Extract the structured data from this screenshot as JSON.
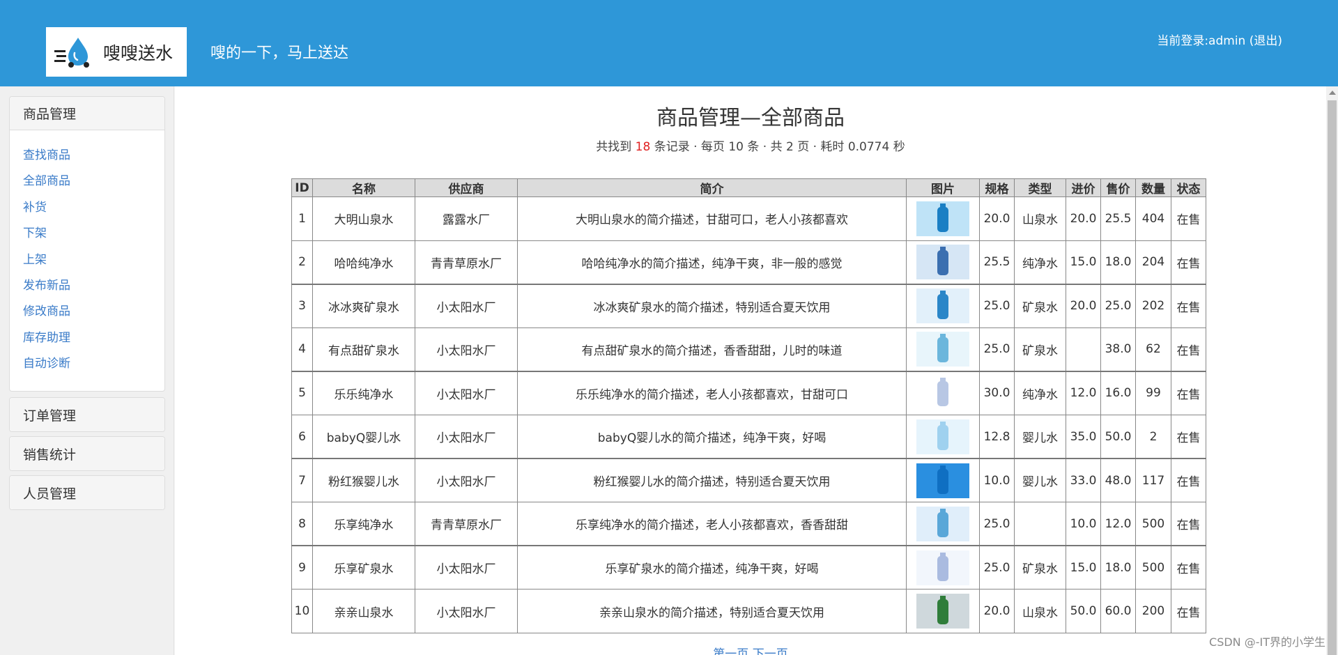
{
  "header": {
    "logo_text": "嗖嗖送水",
    "slogan": "嗖的一下，马上送达",
    "login_prefix": "当前登录:admin",
    "logout_label": "(退出)"
  },
  "sidebar": {
    "goods": {
      "title": "商品管理",
      "items": [
        "查找商品",
        "全部商品",
        "补货",
        "下架",
        "上架",
        "发布新品",
        "修改商品",
        "库存助理",
        "自动诊断"
      ]
    },
    "orders": {
      "title": "订单管理"
    },
    "sales": {
      "title": "销售统计"
    },
    "staff": {
      "title": "人员管理"
    }
  },
  "main": {
    "title": "商品管理—全部商品",
    "summary": {
      "prefix": "共找到",
      "count": "18",
      "suffix": "条记录 · 每页 10 条 · 共 2 页 · 耗时 0.0774 秒"
    },
    "table": {
      "headers": [
        "ID",
        "名称",
        "供应商",
        "简介",
        "图片",
        "规格",
        "类型",
        "进价",
        "售价",
        "数量",
        "状态"
      ],
      "rows": [
        [
          "1",
          "大明山泉水",
          "露露水厂",
          "大明山泉水的简介描述，甘甜可口，老人小孩都喜欢",
          "",
          "20.0",
          "山泉水",
          "20.0",
          "25.5",
          "404",
          "在售"
        ],
        [
          "2",
          "哈哈纯净水",
          "青青草原水厂",
          "哈哈纯净水的简介描述，纯净干爽，非一般的感觉",
          "",
          "25.5",
          "纯净水",
          "15.0",
          "18.0",
          "204",
          "在售"
        ],
        [
          "3",
          "冰冰爽矿泉水",
          "小太阳水厂",
          "冰冰爽矿泉水的简介描述，特别适合夏天饮用",
          "",
          "25.0",
          "矿泉水",
          "20.0",
          "25.0",
          "202",
          "在售"
        ],
        [
          "4",
          "有点甜矿泉水",
          "小太阳水厂",
          "有点甜矿泉水的简介描述，香香甜甜，儿时的味道",
          "",
          "25.0",
          "矿泉水",
          "",
          "38.0",
          "62",
          "在售"
        ],
        [
          "5",
          "乐乐纯净水",
          "小太阳水厂",
          "乐乐纯净水的简介描述，老人小孩都喜欢，甘甜可口",
          "",
          "30.0",
          "纯净水",
          "12.0",
          "16.0",
          "99",
          "在售"
        ],
        [
          "6",
          "babyQ婴儿水",
          "小太阳水厂",
          "babyQ婴儿水的简介描述，纯净干爽，好喝",
          "",
          "12.8",
          "婴儿水",
          "35.0",
          "50.0",
          "2",
          "在售"
        ],
        [
          "7",
          "粉红猴婴儿水",
          "小太阳水厂",
          "粉红猴婴儿水的简介描述，特别适合夏天饮用",
          "",
          "10.0",
          "婴儿水",
          "33.0",
          "48.0",
          "117",
          "在售"
        ],
        [
          "8",
          "乐享纯净水",
          "青青草原水厂",
          "乐享纯净水的简介描述，老人小孩都喜欢，香香甜甜",
          "",
          "25.0",
          "",
          "10.0",
          "12.0",
          "500",
          "在售"
        ],
        [
          "9",
          "乐享矿泉水",
          "小太阳水厂",
          "乐享矿泉水的简介描述，纯净干爽，好喝",
          "",
          "25.0",
          "矿泉水",
          "15.0",
          "18.0",
          "500",
          "在售"
        ],
        [
          "10",
          "亲亲山泉水",
          "小太阳水厂",
          "亲亲山泉水的简介描述，特别适合夏天饮用",
          "",
          "20.0",
          "山泉水",
          "50.0",
          "60.0",
          "200",
          "在售"
        ]
      ]
    },
    "pager": "第一页 下一页"
  },
  "watermark": "CSDN @-IT界的小学生",
  "colors": {
    "header_bg": "#2e97d8",
    "link": "#3a7bc8",
    "highlight": "#e02020"
  }
}
